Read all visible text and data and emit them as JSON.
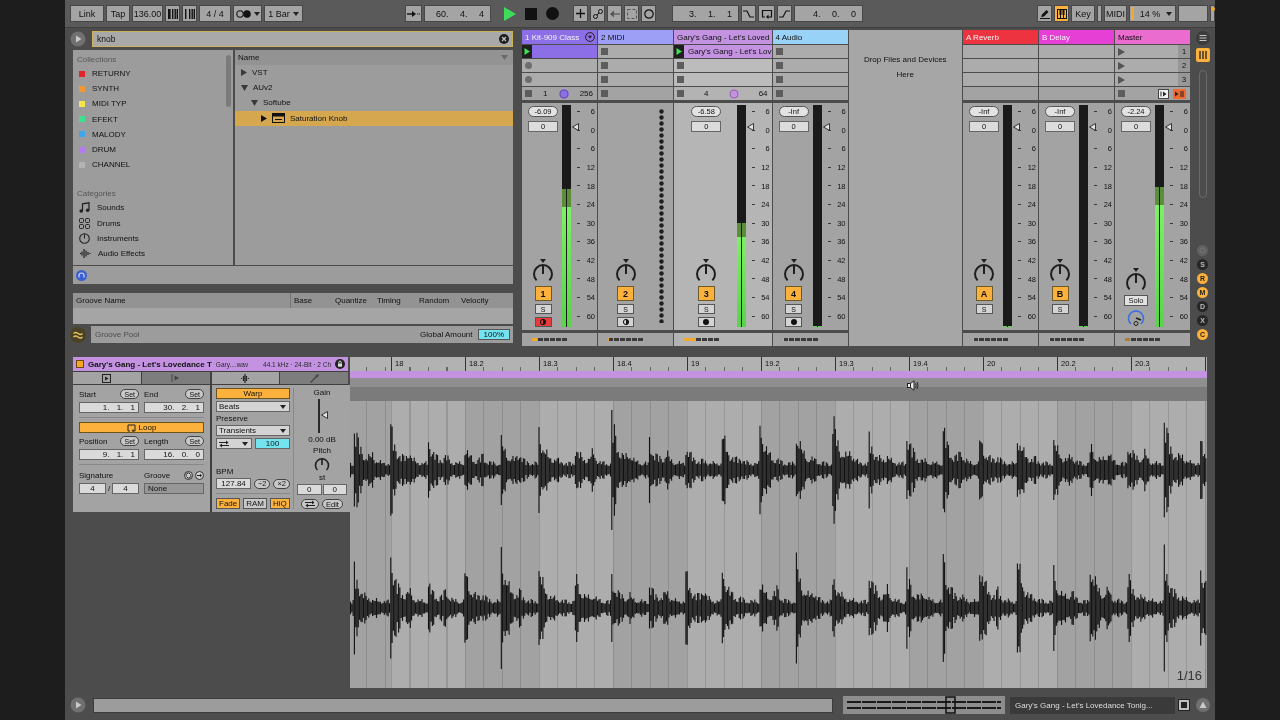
{
  "transport": {
    "link": "Link",
    "tap": "Tap",
    "tempo": "136.00",
    "signature": "4 / 4",
    "quantization": "1 Bar",
    "position": "60. 4. 4",
    "playing": true,
    "loop_start": "3. 1. 1",
    "loop_switch": {
      "on": false
    },
    "loop_length": "4. 0. 0",
    "pencil": {
      "on": false
    },
    "computer_keyboard": {
      "on": true
    },
    "key": "Key",
    "midi": "MIDI",
    "cpu": "14 %"
  },
  "browser": {
    "search": {
      "value": "knob"
    },
    "collections": {
      "title": "Collections",
      "items": [
        {
          "label": "RETURNY",
          "color": "#e4232b"
        },
        {
          "label": "SYNTH",
          "color": "#f29a32"
        },
        {
          "label": "MIDI TYP",
          "color": "#f2e64c"
        },
        {
          "label": "EFEKT",
          "color": "#42e08e"
        },
        {
          "label": "MALODY",
          "color": "#3ea6ef"
        },
        {
          "label": "DRUM",
          "color": "#b27cf0"
        },
        {
          "label": "CHANNEL",
          "color": "#b4b4b4"
        }
      ]
    },
    "categories": {
      "title": "Categories",
      "items": [
        {
          "kind": "sounds",
          "label": "Sounds"
        },
        {
          "kind": "drums",
          "label": "Drums"
        },
        {
          "kind": "instruments",
          "label": "Instruments"
        },
        {
          "kind": "audio_effects",
          "label": "Audio Effects"
        }
      ]
    },
    "files": {
      "column": "Name",
      "tree": [
        {
          "label": "VST",
          "expanded": false,
          "selected": false
        },
        {
          "label": "AUv2",
          "expanded": true,
          "selected": false,
          "children": [
            {
              "label": "Softube",
              "expanded": true,
              "selected": false,
              "children": [
                {
                  "label": "Saturation Knob",
                  "kind": "plugin",
                  "expanded": false,
                  "selected": true
                }
              ]
            }
          ]
        }
      ]
    }
  },
  "groove_pool": {
    "columns": [
      "Groove Name",
      "Base",
      "Quantize",
      "Timing",
      "Random",
      "Velocity"
    ],
    "title": "Groove Pool",
    "global_amount_label": "Global Amount",
    "global_amount": "100%"
  },
  "mixer": {
    "tracks": [
      {
        "kind": "instrument",
        "name": "1 Kit-909 Class",
        "color": "#8c6fe6",
        "selected": false,
        "foldable": true,
        "slots": [
          {
            "kind": "clip",
            "playing": true
          },
          {
            "kind": "record"
          },
          {
            "kind": "record"
          }
        ],
        "stop_row": {
          "texts": [
            "1",
            "256"
          ],
          "knob": true
        },
        "peak": "-6.09",
        "volume": "0",
        "meter": {
          "level": 0.62
        },
        "fader": {
          "level": 0.9
        },
        "scale": [
          "6",
          "0",
          "6",
          "12",
          "18",
          "24",
          "30",
          "36",
          "42",
          "48",
          "54",
          "60"
        ],
        "activator": {
          "label": "1",
          "on": true
        },
        "solo": {
          "label": "S",
          "on": false
        },
        "arm": {
          "on": true
        },
        "activity": {
          "level": 0.17
        }
      },
      {
        "kind": "midi",
        "name": "2 MIDI",
        "color": "#9d9ff6",
        "selected": false,
        "foldable": false,
        "slots": [
          {
            "kind": "empty"
          },
          {
            "kind": "empty"
          },
          {
            "kind": "empty"
          }
        ],
        "stop_row": {
          "knob": false
        },
        "activator": {
          "label": "2",
          "on": true
        },
        "solo": {
          "label": "S",
          "on": false
        },
        "arm": {
          "on": false
        },
        "activity": {
          "level": 0
        }
      },
      {
        "kind": "audio",
        "name": "Gary's Gang - Let's Loved",
        "color": "#c393e2",
        "selected": true,
        "foldable": false,
        "slots": [
          {
            "kind": "clip",
            "name": "Gary's Gang - Let's Lov",
            "playing": true
          },
          {
            "kind": "empty"
          },
          {
            "kind": "empty"
          }
        ],
        "stop_row": {
          "texts": [
            "4",
            "64"
          ],
          "knob": true
        },
        "peak": "-6.58",
        "volume": "0",
        "meter": {
          "level": 0.47
        },
        "fader": {
          "level": 0.9
        },
        "scale": [
          "6",
          "0",
          "6",
          "12",
          "18",
          "24",
          "30",
          "36",
          "42",
          "48",
          "54",
          "60"
        ],
        "activator": {
          "label": "3",
          "on": true
        },
        "solo": {
          "label": "S",
          "on": false
        },
        "arm": {
          "on": false
        },
        "activity": {
          "level": 0.33
        }
      },
      {
        "kind": "audio",
        "name": "4 Audio",
        "color": "#98d2f6",
        "selected": false,
        "foldable": false,
        "slots": [
          {
            "kind": "empty"
          },
          {
            "kind": "empty"
          },
          {
            "kind": "empty"
          }
        ],
        "stop_row": {
          "knob": false
        },
        "peak": "-Inf",
        "volume": "0",
        "meter": {
          "level": 0
        },
        "fader": {
          "level": 0.9
        },
        "scale": [
          "6",
          "0",
          "6",
          "12",
          "18",
          "24",
          "30",
          "36",
          "42",
          "48",
          "54",
          "60"
        ],
        "activator": {
          "label": "4",
          "on": true
        },
        "solo": {
          "label": "S",
          "on": false
        },
        "arm": {
          "on": false
        },
        "activity": {
          "level": 0
        }
      }
    ],
    "drop_hint": "Drop Files and Devices Here",
    "returns": [
      {
        "kind": "return",
        "name": "A Reverb",
        "color": "#ee3340",
        "selected": false,
        "peak": "-Inf",
        "volume": "0",
        "meter": {
          "level": 0
        },
        "fader": {
          "level": 0.9
        },
        "scale": [
          "6",
          "0",
          "6",
          "12",
          "18",
          "24",
          "30",
          "36",
          "42",
          "48",
          "54",
          "60"
        ],
        "activator": {
          "label": "A",
          "on": true
        },
        "solo": {
          "label": "S",
          "on": false
        },
        "activity": {
          "level": 0
        }
      },
      {
        "kind": "return",
        "name": "B Delay",
        "color": "#e63fd6",
        "selected": false,
        "peak": "-Inf",
        "volume": "0",
        "meter": {
          "level": 0
        },
        "fader": {
          "level": 0.9
        },
        "scale": [
          "6",
          "0",
          "6",
          "12",
          "18",
          "24",
          "30",
          "36",
          "42",
          "48",
          "54",
          "60"
        ],
        "activator": {
          "label": "B",
          "on": true
        },
        "solo": {
          "label": "S",
          "on": false
        },
        "activity": {
          "level": 0
        }
      }
    ],
    "master": {
      "kind": "master",
      "name": "Master",
      "color": "#ea6cce",
      "selected": false,
      "scenes": [
        {
          "label": "1"
        },
        {
          "label": "2"
        },
        {
          "label": "3"
        }
      ],
      "peak": "-2.24",
      "volume": "0",
      "meter": {
        "level": 0.63
      },
      "fader": {
        "level": 0.9
      },
      "scale": [
        "6",
        "0",
        "6",
        "12",
        "18",
        "24",
        "30",
        "36",
        "42",
        "48",
        "54",
        "60"
      ],
      "cue": "Solo",
      "activity": {
        "level": 0.17
      }
    },
    "section_toggles": [
      {
        "label": "S",
        "on": false
      },
      {
        "label": "R",
        "on": true
      },
      {
        "label": "M",
        "on": true
      },
      {
        "label": "D",
        "on": false
      },
      {
        "label": "X",
        "on": false
      },
      {
        "label": "C",
        "on": true
      }
    ]
  },
  "clip": {
    "title": "Gary's Gang - Let's Lovedance T",
    "file": "Gary....wav",
    "format": "44.1 kHz · 24-Bit · 2 Ch",
    "left_tabs": [
      {
        "kind": "clip",
        "selected": true
      },
      {
        "kind": "notes",
        "selected": false
      }
    ],
    "right_tabs": [
      {
        "kind": "audio",
        "selected": true
      },
      {
        "kind": "envelope",
        "selected": false
      }
    ],
    "start": {
      "label": "Start",
      "button": "Set",
      "value": "1. 1. 1"
    },
    "end": {
      "label": "End",
      "button": "Set",
      "value": "30. 2. 1"
    },
    "loop": {
      "label": "Loop",
      "on": true
    },
    "position": {
      "label": "Position",
      "button": "Set",
      "value": "9. 1. 1"
    },
    "length": {
      "label": "Length",
      "button": "Set",
      "value": "16. 0. 0"
    },
    "signature": {
      "label": "Signature",
      "numerator": "4",
      "separator": "/",
      "denominator": "4"
    },
    "groove": {
      "label": "Groove",
      "value": "None"
    },
    "warp": {
      "label": "Warp",
      "on": true
    },
    "warp_mode": "Beats",
    "preserve": {
      "label": "Preserve",
      "value": "Transients"
    },
    "envelope_value": "100",
    "bpm": {
      "label": "BPM",
      "value": "127.84",
      "halve": "÷2",
      "double": "×2"
    },
    "options": [
      {
        "label": "Fade",
        "on": true
      },
      {
        "label": "RAM",
        "on": false
      },
      {
        "label": "HiQ",
        "on": true
      }
    ],
    "gain": {
      "label": "Gain",
      "level": 0.55,
      "value": "0.00 dB"
    },
    "pitch": {
      "label": "Pitch",
      "unit": "st",
      "values": [
        "0",
        "0"
      ]
    },
    "edit": "Edit"
  },
  "sample_editor": {
    "ruler": [
      "18",
      "18.2",
      "18.3",
      "18.4",
      "19",
      "19.2",
      "19.3",
      "19.4",
      "20",
      "20.2",
      "20.3"
    ],
    "grid": "1/16"
  },
  "status_bar": {
    "clip_name": "Gary's Gang - Let's Lovedance Tonig..."
  }
}
